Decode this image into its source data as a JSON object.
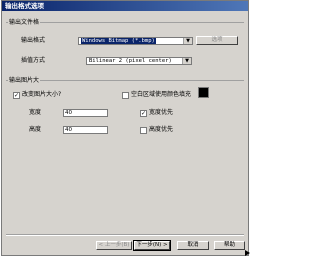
{
  "window": {
    "title": "输出格式选项"
  },
  "output_file": {
    "group_label": "输出文件格",
    "format_label": "输出格式",
    "format_value": "Windows Bitmap (*.bmp)",
    "options_button": "选项",
    "interp_label": "插值方式",
    "interp_value": "Bilinear 2 (pixel center)"
  },
  "output_size": {
    "group_label": "输出图片大",
    "resize_label": "改变图片大小?",
    "fill_label": "空白区域使用颜色填充",
    "width_label": "宽度",
    "width_value": "40",
    "height_label": "高度",
    "height_value": "40",
    "width_priority_label": "宽度优先",
    "height_priority_label": "高度优先",
    "resize_checked": "✓",
    "width_priority_checked": "✓",
    "fill_color": "#000000"
  },
  "buttons": {
    "back": "< 上一步(B)",
    "next": "下一步(N) >",
    "cancel": "取消",
    "help": "帮助"
  }
}
